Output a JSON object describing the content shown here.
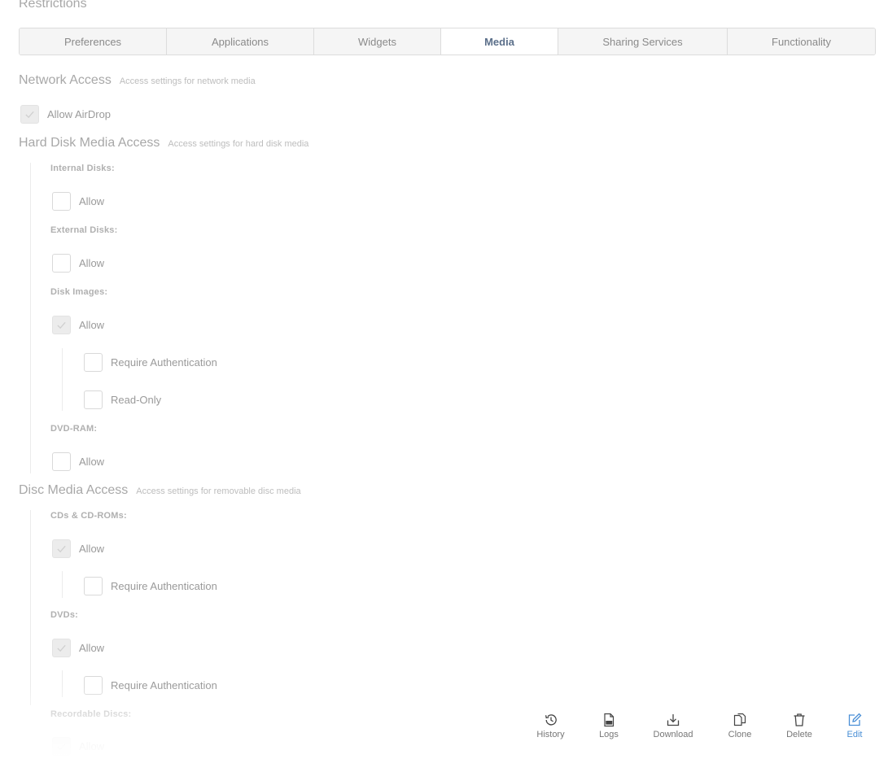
{
  "page": {
    "title": "Restrictions"
  },
  "tabs": [
    {
      "label": "Preferences",
      "active": false
    },
    {
      "label": "Applications",
      "active": false
    },
    {
      "label": "Widgets",
      "active": false
    },
    {
      "label": "Media",
      "active": true
    },
    {
      "label": "Sharing Services",
      "active": false
    },
    {
      "label": "Functionality",
      "active": false
    }
  ],
  "network_access": {
    "title": "Network Access",
    "description": "Access settings for network media",
    "allow_airdrop": {
      "label": "Allow AirDrop",
      "checked": true
    }
  },
  "hard_disk": {
    "title": "Hard Disk Media Access",
    "description": "Access settings for hard disk media",
    "internal_disks": {
      "label": "Internal Disks:",
      "allow": {
        "label": "Allow",
        "checked": false
      }
    },
    "external_disks": {
      "label": "External Disks:",
      "allow": {
        "label": "Allow",
        "checked": false
      }
    },
    "disk_images": {
      "label": "Disk Images:",
      "allow": {
        "label": "Allow",
        "checked": true
      },
      "require_auth": {
        "label": "Require Authentication",
        "checked": false
      },
      "read_only": {
        "label": "Read-Only",
        "checked": false
      }
    },
    "dvd_ram": {
      "label": "DVD-RAM:",
      "allow": {
        "label": "Allow",
        "checked": false
      }
    }
  },
  "disc_media": {
    "title": "Disc Media Access",
    "description": "Access settings for removable disc media",
    "cds": {
      "label": "CDs & CD-ROMs:",
      "allow": {
        "label": "Allow",
        "checked": true
      },
      "require_auth": {
        "label": "Require Authentication",
        "checked": false
      }
    },
    "dvds": {
      "label": "DVDs:",
      "allow": {
        "label": "Allow",
        "checked": true
      },
      "require_auth": {
        "label": "Require Authentication",
        "checked": false
      }
    },
    "recordable": {
      "label": "Recordable Discs:",
      "allow": {
        "label": "Allow",
        "checked": true
      }
    }
  },
  "toolbar": {
    "history": "History",
    "logs": "Logs",
    "download": "Download",
    "clone": "Clone",
    "delete": "Delete",
    "edit": "Edit"
  },
  "colors": {
    "accent": "#4a8fd6",
    "active_tab_text": "#5b6f8a",
    "checked_fill": "#ececec"
  }
}
